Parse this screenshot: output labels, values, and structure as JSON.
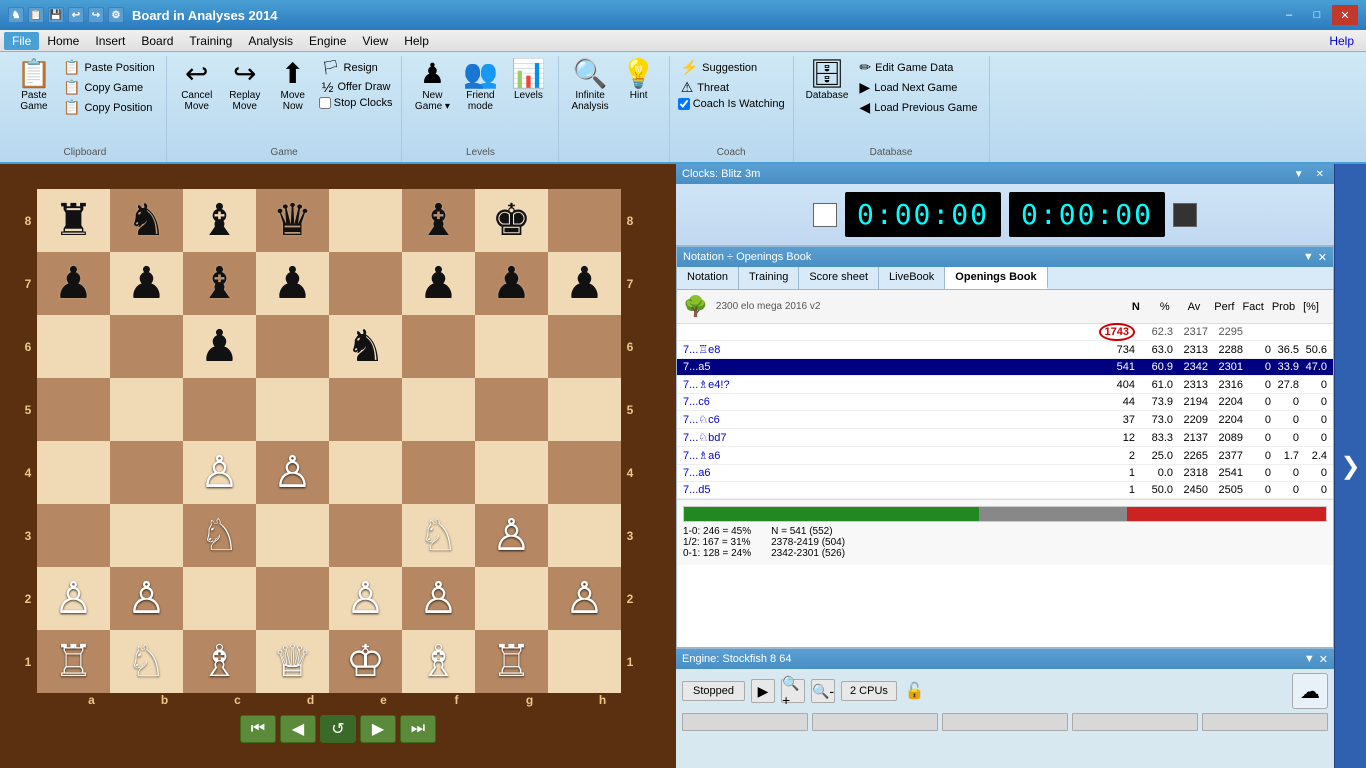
{
  "titleBar": {
    "title": "Board in Analyses 2014",
    "icons": [
      "📋",
      "💾",
      "↩",
      "↪",
      "⚙"
    ],
    "minBtn": "–",
    "maxBtn": "□",
    "closeBtn": "✕"
  },
  "menuBar": {
    "items": [
      "File",
      "Home",
      "Insert",
      "Board",
      "Training",
      "Analysis",
      "Engine",
      "View",
      "Help"
    ],
    "activeItem": "File",
    "helpLink": "Help"
  },
  "ribbon": {
    "clipboard": {
      "label": "Clipboard",
      "pasteGame": "Paste Game",
      "pastePosition": "Paste Position",
      "copyGame": "Copy Game",
      "copyPosition": "Copy Position",
      "pasteLabel": "Paste\nGame"
    },
    "game": {
      "label": "Game",
      "cancelMove": "Cancel Move",
      "replayMove": "Replay Move",
      "moveNow": "Move Now",
      "resign": "Resign",
      "offerDraw": "Offer Draw",
      "stopClocks": "Stop Clocks"
    },
    "newGame": {
      "label": "",
      "label2": "New Game",
      "friendMode": "Friend mode",
      "levels": "Levels"
    },
    "levels": {
      "label": "Levels",
      "infiniteAnalysis": "Infinite Analysis",
      "hint": "Hint"
    },
    "coach": {
      "label": "Coach",
      "suggestion": "Suggestion",
      "threat": "Threat",
      "coachIsWatching": "Coach Is Watching"
    },
    "database": {
      "label": "Database",
      "editGameData": "Edit Game Data",
      "loadNextGame": "Load Next Game",
      "loadPreviousGame": "Load Previous Game"
    }
  },
  "clocks": {
    "title": "Clocks: Blitz 3m",
    "white": "0:00:00",
    "black": "0:00:00"
  },
  "notation": {
    "title": "Notation ÷ Openings Book",
    "tabs": [
      "Notation",
      "Training",
      "Score sheet",
      "LiveBook",
      "Openings Book"
    ],
    "activeTab": "Openings Book"
  },
  "openingsBook": {
    "treeIcon": "🌳",
    "eloInfo": "2300 elo mega 2016 v2",
    "columns": [
      "",
      "N",
      "%",
      "Av",
      "Perf",
      "Fact",
      "Prob",
      "[%]"
    ],
    "totalRow": {
      "n": "1743",
      "pct": "62.3",
      "av": "2317",
      "perf": "2295",
      "fact": "",
      "prob": "",
      "bracket": ""
    },
    "moves": [
      {
        "move": "7...♖e8",
        "n": "734",
        "pct": "63.0",
        "av": "2313",
        "perf": "2288",
        "fact": "0",
        "prob": "36.5",
        "bracket": "50.6"
      },
      {
        "move": "7...a5",
        "n": "541",
        "pct": "60.9",
        "av": "2342",
        "perf": "2301",
        "fact": "0",
        "prob": "33.9",
        "bracket": "47.0",
        "selected": true
      },
      {
        "move": "7...♗e4!?",
        "n": "404",
        "pct": "61.0",
        "av": "2313",
        "perf": "2316",
        "fact": "0",
        "prob": "27.8",
        "bracket": "0"
      },
      {
        "move": "7...c6",
        "n": "44",
        "pct": "73.9",
        "av": "2194",
        "perf": "2204",
        "fact": "0",
        "prob": "0",
        "bracket": "0"
      },
      {
        "move": "7...♘c6",
        "n": "37",
        "pct": "73.0",
        "av": "2209",
        "perf": "2204",
        "fact": "0",
        "prob": "0",
        "bracket": "0"
      },
      {
        "move": "7...♘bd7",
        "n": "12",
        "pct": "83.3",
        "av": "2137",
        "perf": "2089",
        "fact": "0",
        "prob": "0",
        "bracket": "0"
      },
      {
        "move": "7...♗a6",
        "n": "2",
        "pct": "25.0",
        "av": "2265",
        "perf": "2377",
        "fact": "0",
        "prob": "1.7",
        "bracket": "2.4"
      },
      {
        "move": "7...a6",
        "n": "1",
        "pct": "0.0",
        "av": "2318",
        "perf": "2541",
        "fact": "0",
        "prob": "0",
        "bracket": "0"
      },
      {
        "move": "7...d5",
        "n": "1",
        "pct": "50.0",
        "av": "2450",
        "perf": "2505",
        "fact": "0",
        "prob": "0",
        "bracket": "0"
      }
    ],
    "stats": {
      "greenPct": 46,
      "grayPct": 23,
      "redPct": 31,
      "line1": "1-0: 246 = 45%",
      "line2": "1/2: 167 = 31%",
      "line3": "0-1: 128 = 24%",
      "info1": "N = 541 (552)",
      "info2": "2378-2419 (504)",
      "info3": "2342-2301 (526)"
    }
  },
  "engine": {
    "title": "Engine: Stockfish 8 64",
    "stopped": "Stopped",
    "cpus": "2 CPUs"
  },
  "board": {
    "files": [
      "a",
      "b",
      "c",
      "d",
      "e",
      "f",
      "g",
      "h"
    ],
    "ranks": [
      "8",
      "7",
      "6",
      "5",
      "4",
      "3",
      "2",
      "1"
    ],
    "position": [
      [
        "♜",
        "♞",
        "♝",
        "♛",
        "",
        "♝",
        "♚",
        ""
      ],
      [
        "♟",
        "♟",
        "♝",
        "♟",
        "",
        "♟",
        "♟",
        "♟"
      ],
      [
        "",
        "",
        "♟",
        "",
        "♞",
        "",
        "",
        ""
      ],
      [
        "",
        "",
        "",
        "",
        "",
        "",
        "",
        ""
      ],
      [
        "",
        "",
        "♙",
        "♙",
        "",
        "",
        "",
        ""
      ],
      [
        "",
        "",
        "♘",
        "",
        "",
        "♘",
        "♙",
        ""
      ],
      [
        "♙",
        "♙",
        "",
        "",
        "♙",
        "♙",
        "",
        "♙"
      ],
      [
        "♖",
        "♘",
        "♗",
        "♕",
        "♔",
        "♗",
        "♖",
        ""
      ]
    ],
    "navBtns": [
      "⏮",
      "◀",
      "↺",
      "▶",
      "⏭"
    ]
  }
}
